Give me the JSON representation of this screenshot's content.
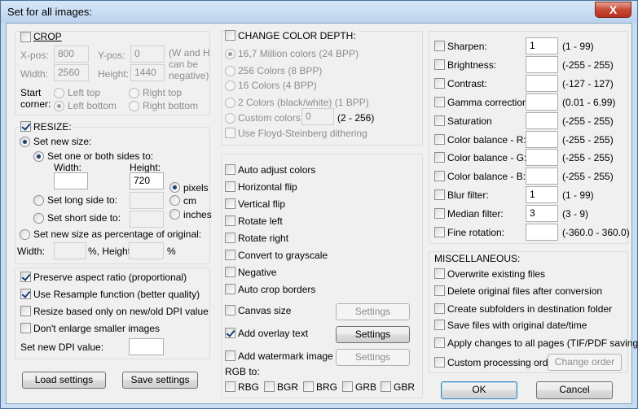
{
  "window": {
    "title": "Set for all images:",
    "close_label": "X"
  },
  "crop": {
    "label": "CROP",
    "checked": false,
    "xpos_label": "X-pos:",
    "xpos_value": "800",
    "ypos_label": "Y-pos:",
    "ypos_value": "0",
    "note": [
      "(W and H",
      "can be",
      "negative)"
    ],
    "width_label": "Width:",
    "width_value": "2560",
    "height_label": "Height:",
    "height_value": "1440",
    "start_label": [
      "Start",
      "corner:"
    ],
    "corners": [
      "Left top",
      "Right top",
      "Left bottom",
      "Right bottom"
    ]
  },
  "resize": {
    "label": "RESIZE:",
    "checked": true,
    "set_new_size": "Set new size:",
    "one_or_both": "Set one or both sides to:",
    "width_label": "Width:",
    "width_value": "",
    "height_label": "Height:",
    "height_value": "720",
    "long_side": "Set long side to:",
    "short_side": "Set short side to:",
    "units": [
      "pixels",
      "cm",
      "inches"
    ],
    "percent_label": "Set new size as percentage of original:",
    "pct_width_label": "Width:",
    "pct_sep": "%, Height:",
    "pct_end": "%"
  },
  "options": {
    "preserve": "Preserve aspect ratio (proportional)",
    "resample": "Use Resample function (better quality)",
    "dpi_only": "Resize based only on new/old DPI value",
    "no_enlarge": "Don't enlarge smaller images",
    "dpi_label": "Set new DPI value:",
    "dpi_value": ""
  },
  "buttons": {
    "load": "Load settings",
    "save": "Save settings",
    "ok": "OK",
    "cancel": "Cancel"
  },
  "color_depth": {
    "label": "CHANGE COLOR DEPTH:",
    "options": [
      "16,7 Million colors (24 BPP)",
      "256 Colors (8 BPP)",
      "16 Colors (4 BPP)",
      "2 Colors (black/white) (1 BPP)"
    ],
    "custom_label": "Custom colors:",
    "custom_value": "0",
    "custom_range": "(2 - 256)",
    "floyd": "Use Floyd-Steinberg dithering"
  },
  "transforms": [
    "Auto adjust colors",
    "Horizontal flip",
    "Vertical flip",
    "Rotate left",
    "Rotate right",
    "Convert to grayscale",
    "Negative",
    "Auto crop borders"
  ],
  "canvas": {
    "label": "Canvas size",
    "button": "Settings"
  },
  "overlay": {
    "label": "Add overlay text",
    "button": "Settings"
  },
  "watermark": {
    "label": "Add watermark image",
    "button": "Settings"
  },
  "rgb": {
    "label": "RGB to:",
    "options": [
      "RBG",
      "BGR",
      "BRG",
      "GRB",
      "GBR"
    ]
  },
  "filters": [
    {
      "label": "Sharpen:",
      "value": "1",
      "range": "(1  -  99)"
    },
    {
      "label": "Brightness:",
      "value": "",
      "range": "(-255  -  255)"
    },
    {
      "label": "Contrast:",
      "value": "",
      "range": "(-127  -  127)"
    },
    {
      "label": "Gamma correction:",
      "value": "",
      "range": "(0.01  -  6.99)"
    },
    {
      "label": "Saturation",
      "value": "",
      "range": "(-255  -  255)"
    },
    {
      "label": "Color balance - R:",
      "value": "",
      "range": "(-255  -  255)"
    },
    {
      "label": "Color balance - G:",
      "value": "",
      "range": "(-255  -  255)"
    },
    {
      "label": "Color balance - B:",
      "value": "",
      "range": "(-255  -  255)"
    },
    {
      "label": "Blur filter:",
      "value": "1",
      "range": "(1  -  99)"
    },
    {
      "label": "Median filter:",
      "value": "3",
      "range": "(3  -  9)"
    },
    {
      "label": "Fine rotation:",
      "value": "",
      "range": "(-360.0  -  360.0)"
    }
  ],
  "misc": {
    "label": "MISCELLANEOUS:",
    "items": [
      "Overwrite existing files",
      "Delete original files after conversion",
      "Create subfolders in destination folder",
      "Save files with original date/time",
      "Apply changes to all pages (TIF/PDF saving)",
      "Custom processing order"
    ],
    "change_order": "Change order"
  }
}
